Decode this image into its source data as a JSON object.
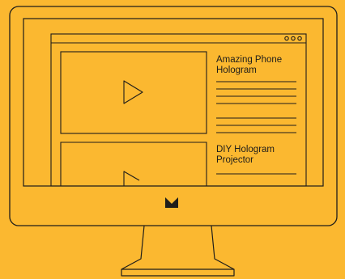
{
  "colors": {
    "background": "#fbb830",
    "stroke": "#1f1d1a"
  },
  "icons": {
    "play": "play-triangle-icon",
    "logo": "monitor-brand-logo-icon",
    "window_controls": "three-dots-icon"
  },
  "browser": {
    "control_count": 3
  },
  "videos": [
    {
      "title_line1": "Amazing Phone",
      "title_line2": "Hologram"
    },
    {
      "title_line1": "DIY Hologram",
      "title_line2": "Projector"
    }
  ]
}
